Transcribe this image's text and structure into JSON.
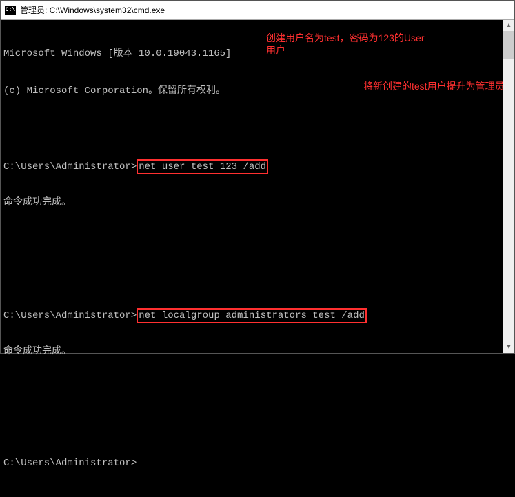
{
  "titlebar": {
    "icon_text": "C:\\",
    "title": "管理员: C:\\Windows\\system32\\cmd.exe"
  },
  "terminal": {
    "header_line1": "Microsoft Windows [版本 10.0.19043.1165]",
    "header_line2": "(c) Microsoft Corporation。保留所有权利。",
    "prompt": "C:\\Users\\Administrator>",
    "cmd1": "net user test 123 /add",
    "success": "命令成功完成。",
    "cmd2": "net localgroup administrators test /add"
  },
  "annotations": {
    "anno1": "创建用户名为test，密码为123的User用户",
    "anno2": "将新创建的test用户提升为管理员"
  },
  "scrollbar": {
    "up": "▴",
    "down": "▾"
  }
}
